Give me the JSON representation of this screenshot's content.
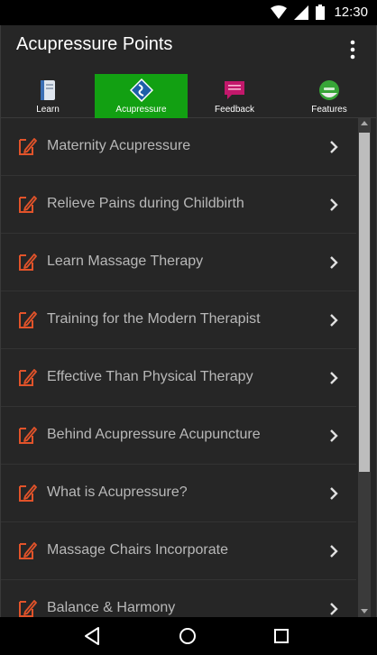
{
  "status_bar": {
    "time": "12:30"
  },
  "app_bar": {
    "title": "Acupressure Points",
    "menu_icon": "overflow-menu-icon"
  },
  "tabs": [
    {
      "label": "Learn",
      "icon": "book-icon",
      "active": false
    },
    {
      "label": "Acupressure",
      "icon": "acupressure-icon",
      "active": true
    },
    {
      "label": "Feedback",
      "icon": "chat-bubble-icon",
      "active": false
    },
    {
      "label": "Features",
      "icon": "sticker-icon",
      "active": false
    }
  ],
  "list": {
    "items": [
      "Maternity Acupressure",
      "Relieve Pains during Childbirth",
      "Learn Massage Therapy",
      "Training for the Modern Therapist",
      "Effective Than Physical Therapy",
      "Behind Acupressure Acupuncture",
      "What is Acupressure?",
      "Massage Chairs Incorporate",
      "Balance & Harmony"
    ]
  },
  "colors": {
    "accent": "#12a012",
    "item_icon": "#e2532a",
    "background": "#262626"
  }
}
